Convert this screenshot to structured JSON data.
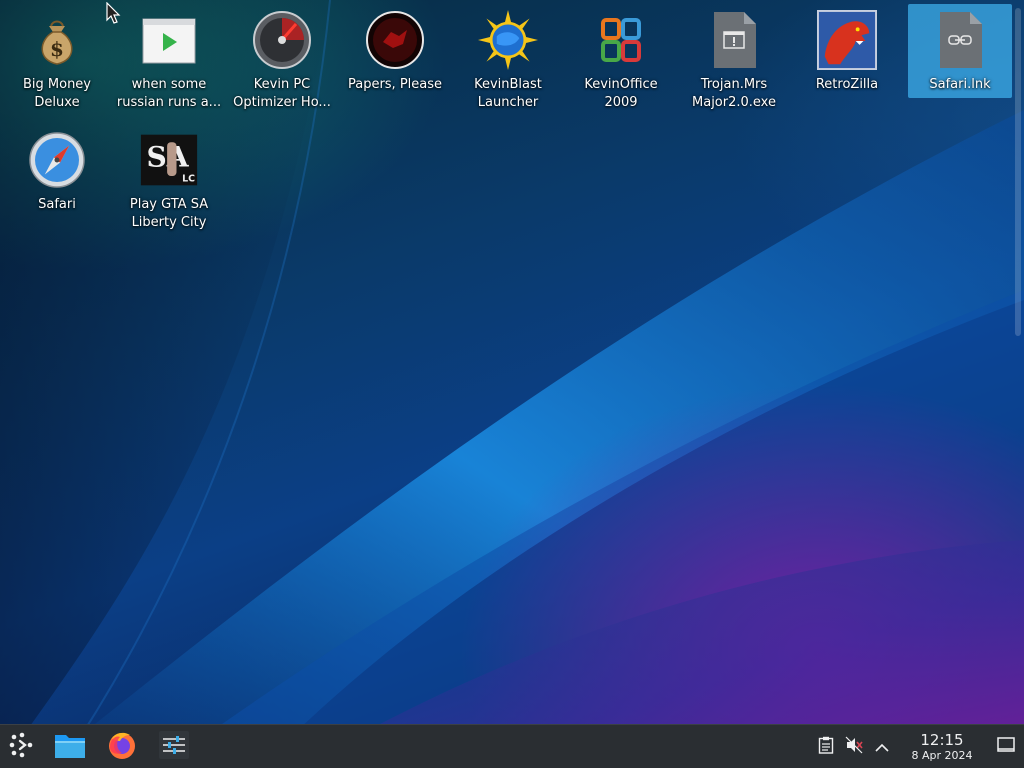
{
  "desktop": {
    "icons": [
      {
        "label": "Big Money Deluxe",
        "icon": "money-bag-icon"
      },
      {
        "label": "when some russian runs a...",
        "icon": "video-player-icon"
      },
      {
        "label": "Kevin PC Optimizer Ho...",
        "icon": "speedometer-icon"
      },
      {
        "label": "Papers, Please",
        "icon": "papers-please-icon"
      },
      {
        "label": "KevinBlast Launcher",
        "icon": "globe-sun-icon"
      },
      {
        "label": "KevinOffice 2009",
        "icon": "office-logo-icon"
      },
      {
        "label": "Trojan.Mrs Major2.0.exe",
        "icon": "executable-file-icon"
      },
      {
        "label": "RetroZilla",
        "icon": "dinosaur-icon"
      },
      {
        "label": "Safari.lnk",
        "icon": "link-file-icon"
      },
      {
        "label": "Safari",
        "icon": "compass-icon"
      },
      {
        "label": "Play GTA SA Liberty City",
        "icon": "gta-logo-icon"
      }
    ],
    "selected_icon": "Safari.lnk"
  },
  "taskbar": {
    "launcher_icon": "application-launcher-icon",
    "pinned": [
      {
        "name": "file-manager",
        "icon": "folder-icon"
      },
      {
        "name": "firefox",
        "icon": "firefox-icon"
      },
      {
        "name": "system-settings",
        "icon": "settings-sliders-icon"
      }
    ],
    "tray": {
      "clipboard_icon": "clipboard-icon",
      "volume_icon": "volume-muted-icon",
      "expand_icon": "chevron-up-icon"
    },
    "clock": {
      "time": "12:15",
      "date": "8 Apr 2024"
    },
    "show_desktop_icon": "show-desktop-icon"
  },
  "colors": {
    "taskbar_bg": "#2a2e32",
    "selection": "#3daee9"
  }
}
